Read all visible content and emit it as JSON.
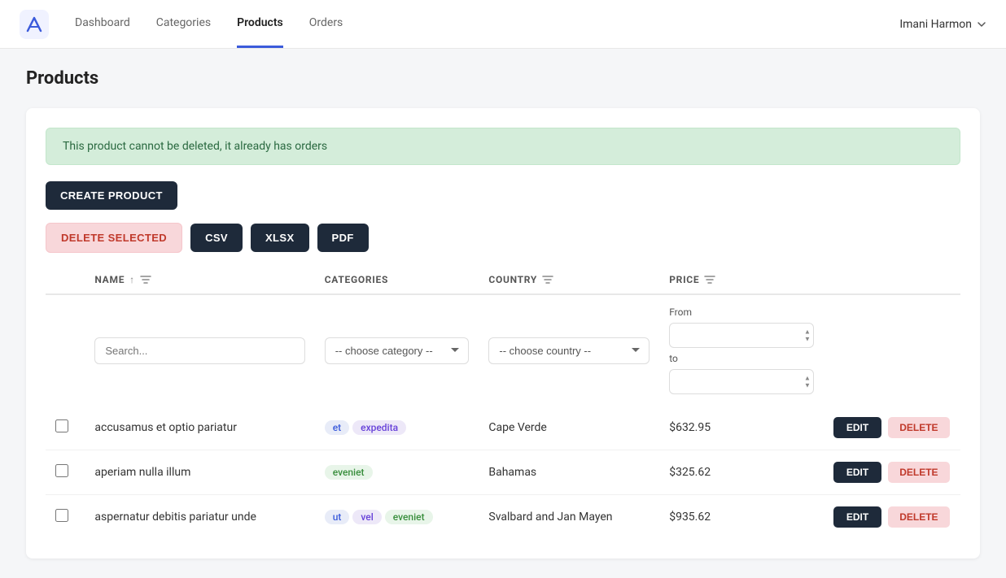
{
  "nav": {
    "links": [
      {
        "label": "Dashboard",
        "active": false,
        "id": "dashboard"
      },
      {
        "label": "Categories",
        "active": false,
        "id": "categories"
      },
      {
        "label": "Products",
        "active": true,
        "id": "products"
      },
      {
        "label": "Orders",
        "active": false,
        "id": "orders"
      }
    ],
    "user": "Imani Harmon",
    "logo_alt": "App Logo"
  },
  "page": {
    "title": "Products"
  },
  "alert": {
    "message": "This product cannot be deleted, it already has orders"
  },
  "toolbar": {
    "create_label": "CREATE PRODUCT",
    "delete_selected_label": "DELETE SELECTED",
    "csv_label": "CSV",
    "xlsx_label": "XLSX",
    "pdf_label": "PDF"
  },
  "table": {
    "columns": {
      "name": "NAME",
      "categories": "CATEGORIES",
      "country": "COUNTRY",
      "price": "PRICE"
    },
    "filters": {
      "search_placeholder": "Search...",
      "category_placeholder": "-- choose category --",
      "country_placeholder": "-- choose country --",
      "price_from_label": "From",
      "price_to_label": "to"
    },
    "rows": [
      {
        "id": 1,
        "name": "accusamus et optio pariatur",
        "categories": [
          {
            "label": "et",
            "color": "blue"
          },
          {
            "label": "expedita",
            "color": "purple"
          }
        ],
        "country": "Cape Verde",
        "price": "$632.95"
      },
      {
        "id": 2,
        "name": "aperiam nulla illum",
        "categories": [
          {
            "label": "eveniet",
            "color": "green"
          }
        ],
        "country": "Bahamas",
        "price": "$325.62"
      },
      {
        "id": 3,
        "name": "aspernatur debitis pariatur unde",
        "categories": [
          {
            "label": "ut",
            "color": "blue"
          },
          {
            "label": "vel",
            "color": "purple"
          },
          {
            "label": "eveniet",
            "color": "green"
          }
        ],
        "country": "Svalbard and Jan Mayen",
        "price": "$935.62"
      }
    ]
  }
}
